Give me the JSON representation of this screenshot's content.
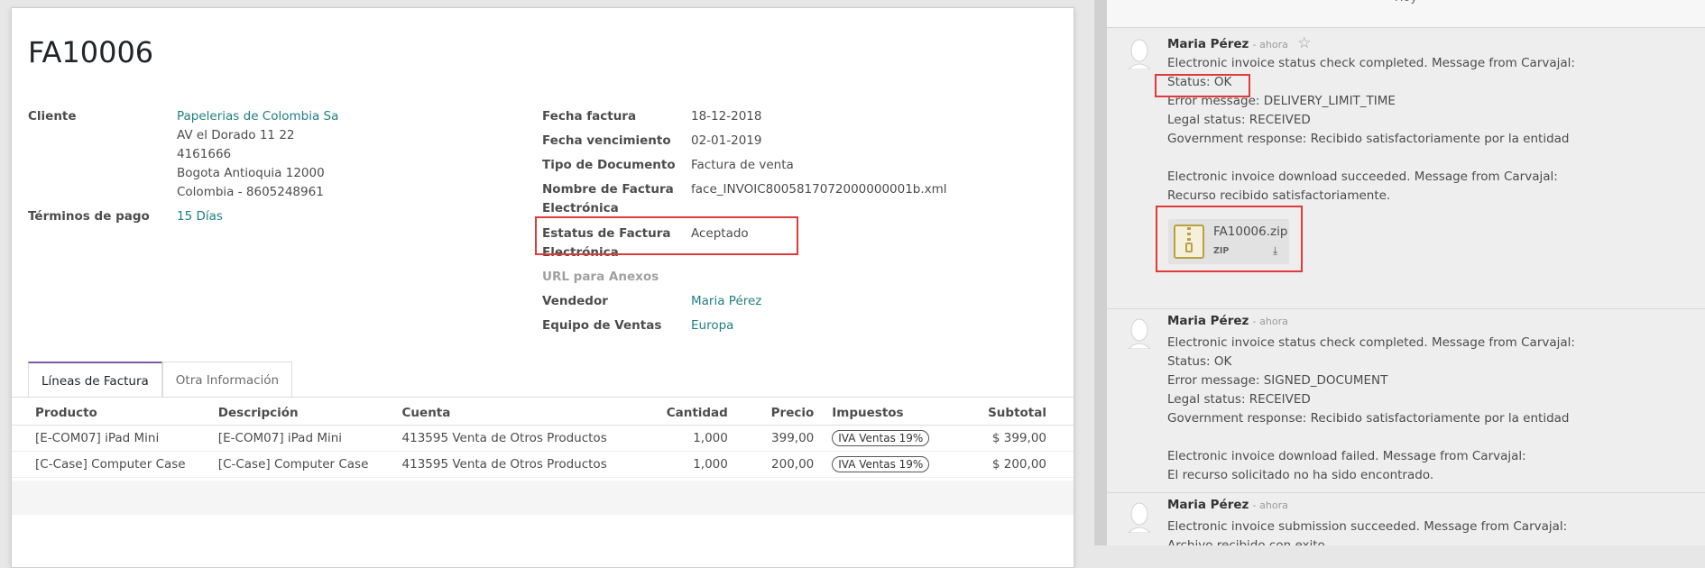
{
  "invoice": {
    "number": "FA10006"
  },
  "customer": {
    "label": "Cliente",
    "name": "Papelerias de Colombia Sa",
    "address_lines": [
      "AV el Dorado 11 22",
      "4161666",
      "Bogota Antioquia 12000",
      "Colombia - 8605248961"
    ]
  },
  "payment_terms": {
    "label": "Términos de pago",
    "value": "15 Días"
  },
  "right_fields": {
    "invoice_date": {
      "label": "Fecha factura",
      "value": "18-12-2018"
    },
    "due_date": {
      "label": "Fecha vencimiento",
      "value": "02-01-2019"
    },
    "doc_type": {
      "label": "Tipo de Documento",
      "value": "Factura de venta"
    },
    "einvoice_name": {
      "label_line1": "Nombre de Factura",
      "label_line2": "Electrónica",
      "value": "face_INVOIC8005817072000000001b.xml"
    },
    "einvoice_status": {
      "label_line1": "Estatus de Factura",
      "label_line2": "Electrónica",
      "value": "Aceptado"
    },
    "annex_url": {
      "label": "URL para Anexos"
    },
    "salesperson": {
      "label": "Vendedor",
      "value": "Maria Pérez"
    },
    "sales_team": {
      "label": "Equipo de Ventas",
      "value": "Europa"
    }
  },
  "tabs": [
    {
      "label": "Líneas de Factura",
      "active": true
    },
    {
      "label": "Otra Información",
      "active": false
    }
  ],
  "lines_table": {
    "headers": [
      "Producto",
      "Descripción",
      "Cuenta",
      "Cantidad",
      "Precio",
      "Impuestos",
      "Subtotal"
    ],
    "rows": [
      {
        "product": "[E-COM07] iPad Mini",
        "description": "[E-COM07] iPad Mini",
        "account": "413595 Venta de Otros Productos",
        "qty": "1,000",
        "price": "399,00",
        "tax": "IVA Ventas 19%",
        "subtotal": "$ 399,00"
      },
      {
        "product": "[C-Case] Computer Case",
        "description": "[C-Case] Computer Case",
        "account": "413595 Venta de Otros Productos",
        "qty": "1,000",
        "price": "200,00",
        "tax": "IVA Ventas 19%",
        "subtotal": "$ 200,00"
      }
    ]
  },
  "chatter": {
    "date_separator": "Hoy",
    "messages": [
      {
        "author": "Maria Pérez",
        "when": "- ahora",
        "lines": [
          "Electronic invoice status check completed. Message from Carvajal:",
          "Status: OK",
          "Error message: DELIVERY_LIMIT_TIME",
          "Legal status: RECEIVED",
          "Government response: Recibido satisfactoriamente por la entidad",
          "",
          "Electronic invoice download succeeded. Message from Carvajal:",
          "Recurso recibido satisfactoriamente."
        ],
        "attachment": {
          "name": "FA10006.zip",
          "ext": "ZIP"
        }
      },
      {
        "author": "Maria Pérez",
        "when": "- ahora",
        "lines": [
          "Electronic invoice status check completed. Message from Carvajal:",
          "Status: OK",
          "Error message: SIGNED_DOCUMENT",
          "Legal status: RECEIVED",
          "Government response: Recibido satisfactoriamente por la entidad",
          "",
          "Electronic invoice download failed. Message from Carvajal:",
          "El recurso solicitado no ha sido encontrado."
        ]
      },
      {
        "author": "Maria Pérez",
        "when": "- ahora",
        "lines": [
          "Electronic invoice submission succeeded. Message from Carvajal:",
          "Archivo recibido con exito"
        ]
      }
    ]
  },
  "colors": {
    "link": "#1f7f84",
    "highlight": "#e03a3a",
    "tab_accent": "#7b5aa6"
  }
}
